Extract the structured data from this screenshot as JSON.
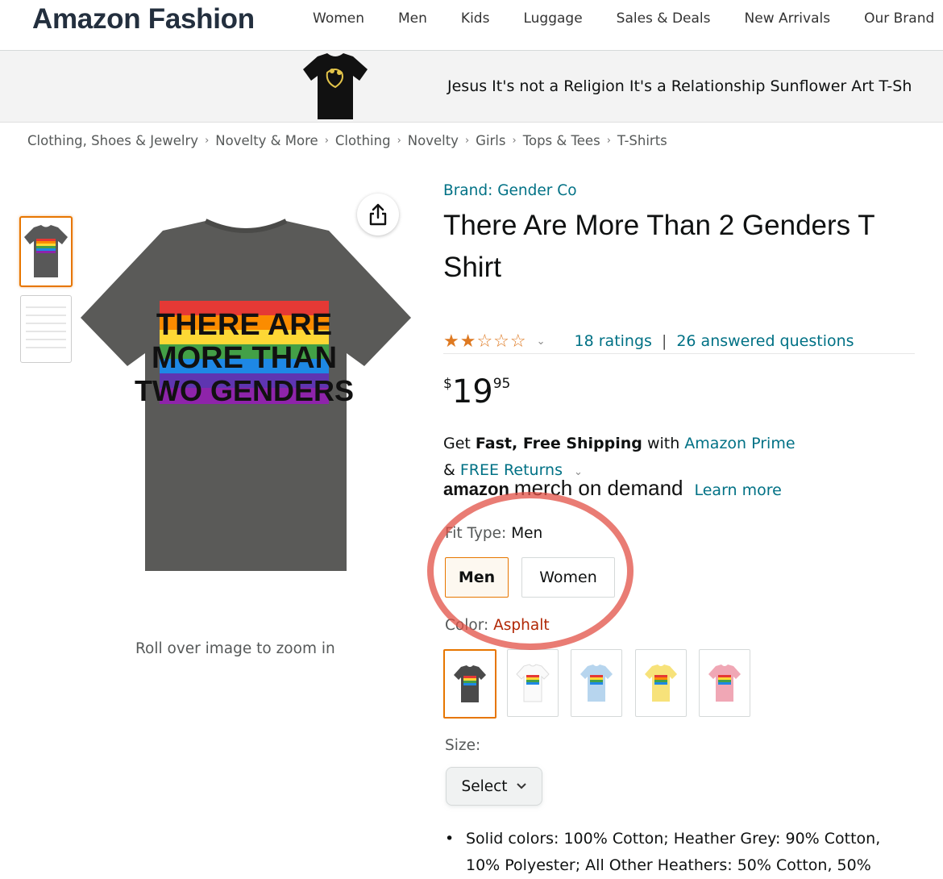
{
  "header": {
    "brand": "Amazon Fashion",
    "nav": [
      "Women",
      "Men",
      "Kids",
      "Luggage",
      "Sales & Deals",
      "New Arrivals",
      "Our Brand"
    ]
  },
  "promo": {
    "text": "Jesus It's not a Religion It's a Relationship Sunflower Art T-Sh"
  },
  "breadcrumb": [
    "Clothing, Shoes & Jewelry",
    "Novelty & More",
    "Clothing",
    "Novelty",
    "Girls",
    "Tops & Tees",
    "T-Shirts"
  ],
  "gallery": {
    "shirt_lines": [
      "THERE ARE",
      "MORE THAN",
      "TWO GENDERS"
    ],
    "zoom_hint": "Roll over image to zoom in"
  },
  "product": {
    "brand_link": "Brand: Gender Co",
    "title_line1": "There Are More Than 2 Genders T",
    "title_line2": "Shirt",
    "rating_stars": 2,
    "ratings_text": "18 ratings",
    "separator": "|",
    "questions_text": "26 answered questions",
    "price": {
      "symbol": "$",
      "whole": "19",
      "fraction": "95"
    },
    "shipping": {
      "get": "Get ",
      "bold": "Fast, Free Shipping",
      "with": " with ",
      "prime": "Amazon Prime",
      "amp": "& ",
      "returns": "FREE Returns"
    },
    "merch": {
      "logo": "amazon",
      "text": "merch on demand",
      "learn_more": "Learn more"
    },
    "fit_type": {
      "label": "Fit Type: ",
      "value": "Men",
      "options": [
        "Men",
        "Women"
      ]
    },
    "color": {
      "label": "Color: ",
      "value": "Asphalt"
    },
    "size": {
      "label": "Size:",
      "select": "Select"
    },
    "bullet_1": "Solid colors: 100% Cotton; Heather Grey: 90% Cotton,",
    "bullet_2": "10% Polyester; All Other Heathers: 50% Cotton, 50%"
  },
  "colors": {
    "accent": "#e77600",
    "link": "#007185",
    "star": "#de7921",
    "annotation": "#e25046",
    "swatches": [
      "#4a4a4a",
      "#ffffff",
      "#b7d5ee",
      "#f7e27a",
      "#f0a7b5"
    ]
  }
}
